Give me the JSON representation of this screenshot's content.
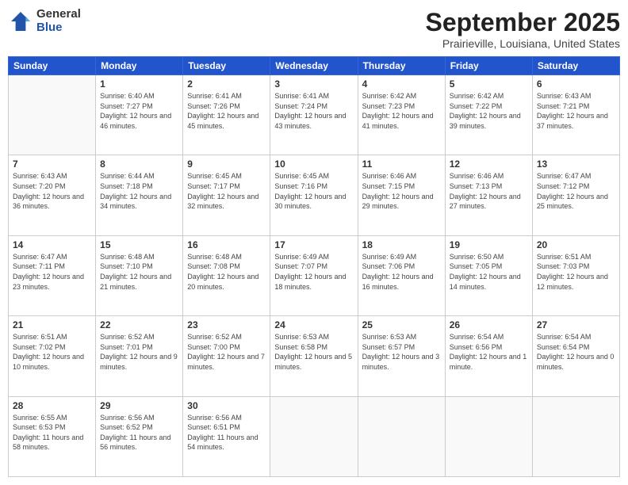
{
  "logo": {
    "general": "General",
    "blue": "Blue"
  },
  "title": {
    "month_year": "September 2025",
    "location": "Prairieville, Louisiana, United States"
  },
  "days_of_week": [
    "Sunday",
    "Monday",
    "Tuesday",
    "Wednesday",
    "Thursday",
    "Friday",
    "Saturday"
  ],
  "weeks": [
    [
      {
        "num": "",
        "sunrise": "",
        "sunset": "",
        "daylight": ""
      },
      {
        "num": "1",
        "sunrise": "Sunrise: 6:40 AM",
        "sunset": "Sunset: 7:27 PM",
        "daylight": "Daylight: 12 hours and 46 minutes."
      },
      {
        "num": "2",
        "sunrise": "Sunrise: 6:41 AM",
        "sunset": "Sunset: 7:26 PM",
        "daylight": "Daylight: 12 hours and 45 minutes."
      },
      {
        "num": "3",
        "sunrise": "Sunrise: 6:41 AM",
        "sunset": "Sunset: 7:24 PM",
        "daylight": "Daylight: 12 hours and 43 minutes."
      },
      {
        "num": "4",
        "sunrise": "Sunrise: 6:42 AM",
        "sunset": "Sunset: 7:23 PM",
        "daylight": "Daylight: 12 hours and 41 minutes."
      },
      {
        "num": "5",
        "sunrise": "Sunrise: 6:42 AM",
        "sunset": "Sunset: 7:22 PM",
        "daylight": "Daylight: 12 hours and 39 minutes."
      },
      {
        "num": "6",
        "sunrise": "Sunrise: 6:43 AM",
        "sunset": "Sunset: 7:21 PM",
        "daylight": "Daylight: 12 hours and 37 minutes."
      }
    ],
    [
      {
        "num": "7",
        "sunrise": "Sunrise: 6:43 AM",
        "sunset": "Sunset: 7:20 PM",
        "daylight": "Daylight: 12 hours and 36 minutes."
      },
      {
        "num": "8",
        "sunrise": "Sunrise: 6:44 AM",
        "sunset": "Sunset: 7:18 PM",
        "daylight": "Daylight: 12 hours and 34 minutes."
      },
      {
        "num": "9",
        "sunrise": "Sunrise: 6:45 AM",
        "sunset": "Sunset: 7:17 PM",
        "daylight": "Daylight: 12 hours and 32 minutes."
      },
      {
        "num": "10",
        "sunrise": "Sunrise: 6:45 AM",
        "sunset": "Sunset: 7:16 PM",
        "daylight": "Daylight: 12 hours and 30 minutes."
      },
      {
        "num": "11",
        "sunrise": "Sunrise: 6:46 AM",
        "sunset": "Sunset: 7:15 PM",
        "daylight": "Daylight: 12 hours and 29 minutes."
      },
      {
        "num": "12",
        "sunrise": "Sunrise: 6:46 AM",
        "sunset": "Sunset: 7:13 PM",
        "daylight": "Daylight: 12 hours and 27 minutes."
      },
      {
        "num": "13",
        "sunrise": "Sunrise: 6:47 AM",
        "sunset": "Sunset: 7:12 PM",
        "daylight": "Daylight: 12 hours and 25 minutes."
      }
    ],
    [
      {
        "num": "14",
        "sunrise": "Sunrise: 6:47 AM",
        "sunset": "Sunset: 7:11 PM",
        "daylight": "Daylight: 12 hours and 23 minutes."
      },
      {
        "num": "15",
        "sunrise": "Sunrise: 6:48 AM",
        "sunset": "Sunset: 7:10 PM",
        "daylight": "Daylight: 12 hours and 21 minutes."
      },
      {
        "num": "16",
        "sunrise": "Sunrise: 6:48 AM",
        "sunset": "Sunset: 7:08 PM",
        "daylight": "Daylight: 12 hours and 20 minutes."
      },
      {
        "num": "17",
        "sunrise": "Sunrise: 6:49 AM",
        "sunset": "Sunset: 7:07 PM",
        "daylight": "Daylight: 12 hours and 18 minutes."
      },
      {
        "num": "18",
        "sunrise": "Sunrise: 6:49 AM",
        "sunset": "Sunset: 7:06 PM",
        "daylight": "Daylight: 12 hours and 16 minutes."
      },
      {
        "num": "19",
        "sunrise": "Sunrise: 6:50 AM",
        "sunset": "Sunset: 7:05 PM",
        "daylight": "Daylight: 12 hours and 14 minutes."
      },
      {
        "num": "20",
        "sunrise": "Sunrise: 6:51 AM",
        "sunset": "Sunset: 7:03 PM",
        "daylight": "Daylight: 12 hours and 12 minutes."
      }
    ],
    [
      {
        "num": "21",
        "sunrise": "Sunrise: 6:51 AM",
        "sunset": "Sunset: 7:02 PM",
        "daylight": "Daylight: 12 hours and 10 minutes."
      },
      {
        "num": "22",
        "sunrise": "Sunrise: 6:52 AM",
        "sunset": "Sunset: 7:01 PM",
        "daylight": "Daylight: 12 hours and 9 minutes."
      },
      {
        "num": "23",
        "sunrise": "Sunrise: 6:52 AM",
        "sunset": "Sunset: 7:00 PM",
        "daylight": "Daylight: 12 hours and 7 minutes."
      },
      {
        "num": "24",
        "sunrise": "Sunrise: 6:53 AM",
        "sunset": "Sunset: 6:58 PM",
        "daylight": "Daylight: 12 hours and 5 minutes."
      },
      {
        "num": "25",
        "sunrise": "Sunrise: 6:53 AM",
        "sunset": "Sunset: 6:57 PM",
        "daylight": "Daylight: 12 hours and 3 minutes."
      },
      {
        "num": "26",
        "sunrise": "Sunrise: 6:54 AM",
        "sunset": "Sunset: 6:56 PM",
        "daylight": "Daylight: 12 hours and 1 minute."
      },
      {
        "num": "27",
        "sunrise": "Sunrise: 6:54 AM",
        "sunset": "Sunset: 6:54 PM",
        "daylight": "Daylight: 12 hours and 0 minutes."
      }
    ],
    [
      {
        "num": "28",
        "sunrise": "Sunrise: 6:55 AM",
        "sunset": "Sunset: 6:53 PM",
        "daylight": "Daylight: 11 hours and 58 minutes."
      },
      {
        "num": "29",
        "sunrise": "Sunrise: 6:56 AM",
        "sunset": "Sunset: 6:52 PM",
        "daylight": "Daylight: 11 hours and 56 minutes."
      },
      {
        "num": "30",
        "sunrise": "Sunrise: 6:56 AM",
        "sunset": "Sunset: 6:51 PM",
        "daylight": "Daylight: 11 hours and 54 minutes."
      },
      {
        "num": "",
        "sunrise": "",
        "sunset": "",
        "daylight": ""
      },
      {
        "num": "",
        "sunrise": "",
        "sunset": "",
        "daylight": ""
      },
      {
        "num": "",
        "sunrise": "",
        "sunset": "",
        "daylight": ""
      },
      {
        "num": "",
        "sunrise": "",
        "sunset": "",
        "daylight": ""
      }
    ]
  ]
}
